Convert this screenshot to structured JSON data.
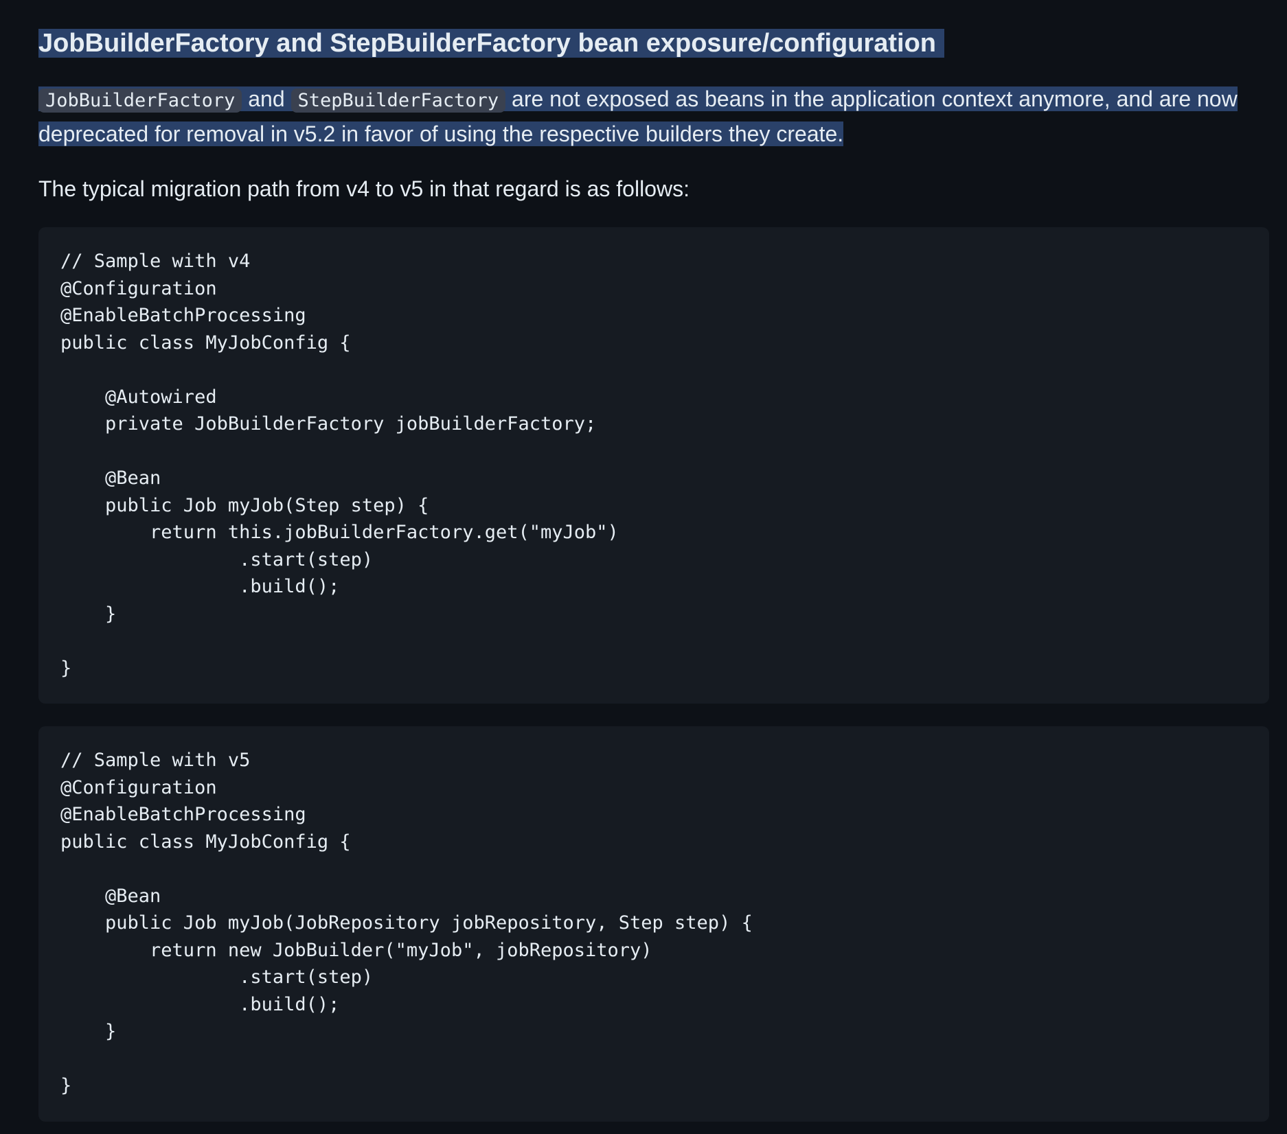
{
  "section": {
    "title": "JobBuilderFactory and StepBuilderFactory bean exposure/configuration",
    "lead": {
      "code1": "JobBuilderFactory",
      "and": "and",
      "code2": "StepBuilderFactory",
      "rest": "are not exposed as beans in the application context anymore, and are now deprecated for removal in v5.2 in favor of using the respective builders they create."
    },
    "intro": "The typical migration path from v4 to v5 in that regard is as follows:"
  },
  "code_blocks": [
    {
      "language": "java",
      "code": "// Sample with v4\n@Configuration\n@EnableBatchProcessing\npublic class MyJobConfig {\n\n    @Autowired\n    private JobBuilderFactory jobBuilderFactory;\n\n    @Bean\n    public Job myJob(Step step) {\n        return this.jobBuilderFactory.get(\"myJob\")\n                .start(step)\n                .build();\n    }\n\n}"
    },
    {
      "language": "java",
      "code": "// Sample with v5\n@Configuration\n@EnableBatchProcessing\npublic class MyJobConfig {\n\n    @Bean\n    public Job myJob(JobRepository jobRepository, Step step) {\n        return new JobBuilder(\"myJob\", jobRepository)\n                .start(step)\n                .build();\n    }\n\n}"
    }
  ]
}
